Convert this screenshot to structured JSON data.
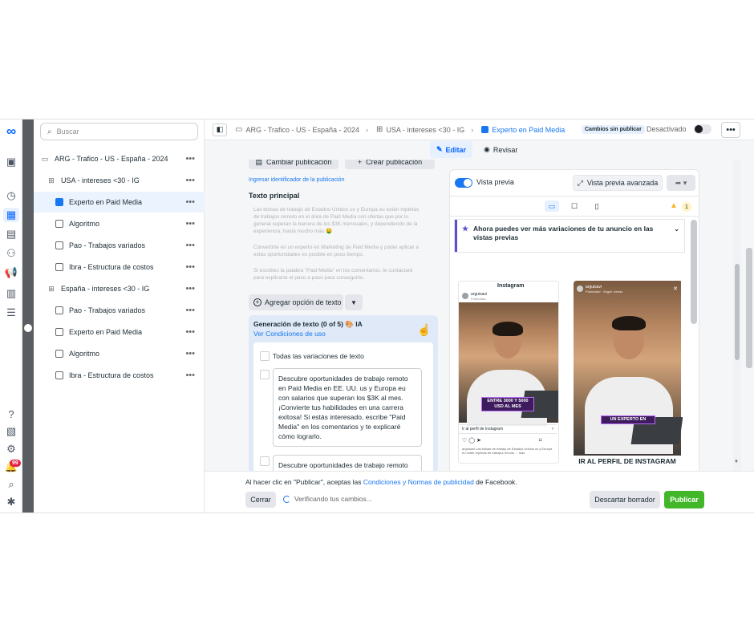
{
  "tree": {
    "search_placeholder": "Buscar",
    "items": [
      {
        "label": "ARG - Trafico - US - España - 2024",
        "kind": "campaign"
      },
      {
        "label": "USA - intereses <30 - IG",
        "kind": "adset"
      },
      {
        "label": "Experto en Paid Media",
        "kind": "ad",
        "selected": true
      },
      {
        "label": "Algoritmo",
        "kind": "ad"
      },
      {
        "label": "Pao - Trabajos variados",
        "kind": "ad"
      },
      {
        "label": "Ibra - Estructura de costos",
        "kind": "ad"
      },
      {
        "label": "España - intereses <30 - IG",
        "kind": "adset"
      },
      {
        "label": "Pao - Trabajos variados",
        "kind": "ad"
      },
      {
        "label": "Experto en Paid Media",
        "kind": "ad"
      },
      {
        "label": "Algoritmo",
        "kind": "ad"
      },
      {
        "label": "Ibra - Estructura de costos",
        "kind": "ad"
      }
    ],
    "more_glyph": "•••"
  },
  "rail": {
    "notification_count": "99"
  },
  "topbar": {
    "breadcrumb": [
      "ARG - Trafico - US - España - 2024",
      "USA - intereses <30 - IG",
      "Experto en Paid Media"
    ],
    "unpublished_badge": "Cambios sin publicar",
    "status": "Desactivado"
  },
  "tabs": {
    "edit": "Editar",
    "review": "Revisar"
  },
  "editor": {
    "change_pub": "Cambiar publicación",
    "create_pub": "Crear publicación",
    "enter_id_link": "Ingresar identificador de la publicación",
    "primary_text_label": "Texto principal",
    "primary_text_paragraphs": [
      "Las bolsas de trabajo de Estados Unidos us y Europa eu están repletas de trabajos remoto en el área de Paid Media con ofertas que por lo general superan la barrera de los $3K mensuales, y dependiendo de la experiencia, hasta mucho más 🤑",
      "Convertirte en un experto en Marketing de Paid Media y poder aplicar a estas oportunidades es posible en poco tiempo.",
      "Si escribes la palabra \"Paid Media\" en los comentarios, te contactaré para explicarte el paso a paso para conseguirlo."
    ],
    "add_text_option": "Agregar opción de texto",
    "generation_title": "Generación de texto (0 of 5) 🎨 IA",
    "terms_link": "Ver Condiciones de uso",
    "all_variations": "Todas las variaciones de texto",
    "variations": [
      "Descubre oportunidades de trabajo remoto en Paid Media en EE. UU. us y Europa eu con salarios que superan los $3K al mes. ¡Convierte tus habilidades en una carrera exitosa! Si estás interesado, escribe \"Paid Media\" en los comentarios y te explicaré cómo lograrlo.",
      "Descubre oportunidades de trabajo remoto"
    ]
  },
  "preview": {
    "toggle_label": "Vista previa",
    "advanced": "Vista previa avanzada",
    "warning_count": "1",
    "notice": "Ahora puedes ver más variaciones de tu anuncio en las vistas previas",
    "feed": {
      "platform_title": "Instagram",
      "account": "arguisavi",
      "sponsored": "Publicidad",
      "video_caption": "ENTRE 3000 Y 5000 USD AL MES",
      "cta": "Ir al perfil de Instagram",
      "caption": "arguisavi Las bolsas de trabajo de Estados Unidos us y Europa eu están repletas de trabajos remoto ... más"
    },
    "story": {
      "account": "arguisavi",
      "sponsored": "Publicidad · Seguir viendo",
      "video_caption": "UN EXPERTO EN",
      "banner": "IR AL PERFIL DE INSTAGRAM"
    }
  },
  "footer": {
    "legal_prefix": "Al hacer clic en \"Publicar\", aceptas las ",
    "legal_link": "Condiciones y Normas de publicidad",
    "legal_suffix": " de Facebook.",
    "close": "Cerrar",
    "verifying": "Verificando tus cambios...",
    "discard": "Descartar borrador",
    "publish": "Publicar"
  }
}
